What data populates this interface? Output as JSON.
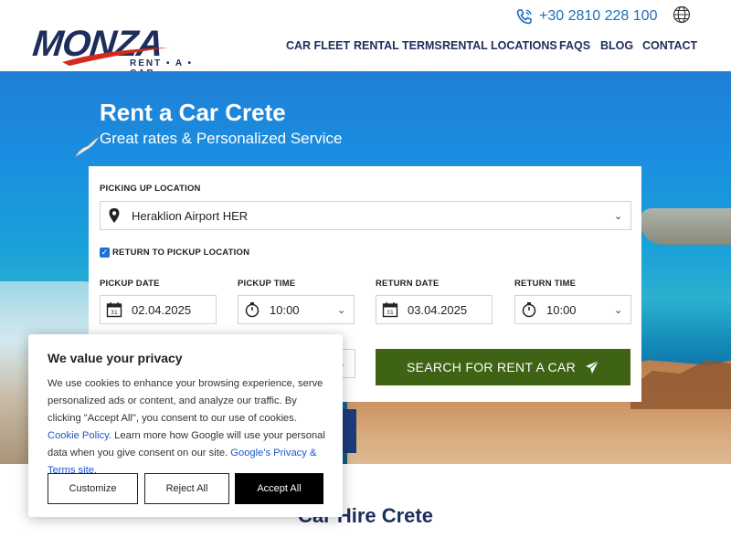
{
  "header": {
    "logo_word": "MONZA",
    "logo_sub": "RENT • A • CAR",
    "phone": "+30 2810 228 100",
    "nav": [
      "CAR FLEET",
      "RENTAL TERMS",
      "RENTAL LOCATIONS",
      "FAQS",
      "BLOG",
      "CONTACT"
    ]
  },
  "hero": {
    "title": "Rent a Car Crete",
    "subtitle": "Great rates & Personalized Service"
  },
  "form": {
    "pickup_location_label": "PICKING UP LOCATION",
    "pickup_location_value": "Heraklion Airport HER",
    "return_checkbox_label": "RETURN TO PICKUP LOCATION",
    "pickup_date_label": "PICKUP DATE",
    "pickup_date_value": "02.04.2025",
    "pickup_time_label": "PICKUP TIME",
    "pickup_time_value": "10:00",
    "return_date_label": "RETURN DATE",
    "return_date_value": "03.04.2025",
    "return_time_label": "RETURN TIME",
    "return_time_value": "10:00",
    "search_button": "SEARCH FOR RENT A CAR"
  },
  "section": {
    "title": "Car Hire Crete"
  },
  "cookie": {
    "title": "We value your privacy",
    "text_before": "We use cookies to enhance your browsing experience, serve personalized ads or content, and analyze our traffic. By clicking \"Accept All\", you consent to our use of cookies. ",
    "cookie_policy_link": "Cookie Policy.",
    "text_middle": " Learn more how Google will use your personal data when you give consent on our site. ",
    "google_link": "Google's Privacy & Terms site.",
    "customize": "Customize",
    "reject": "Reject All",
    "accept": "Accept All"
  },
  "colors": {
    "brand_navy": "#1d2d5c",
    "brand_red": "#d42a1e",
    "search_green": "#3e6314",
    "link_blue": "#1d57c8"
  }
}
